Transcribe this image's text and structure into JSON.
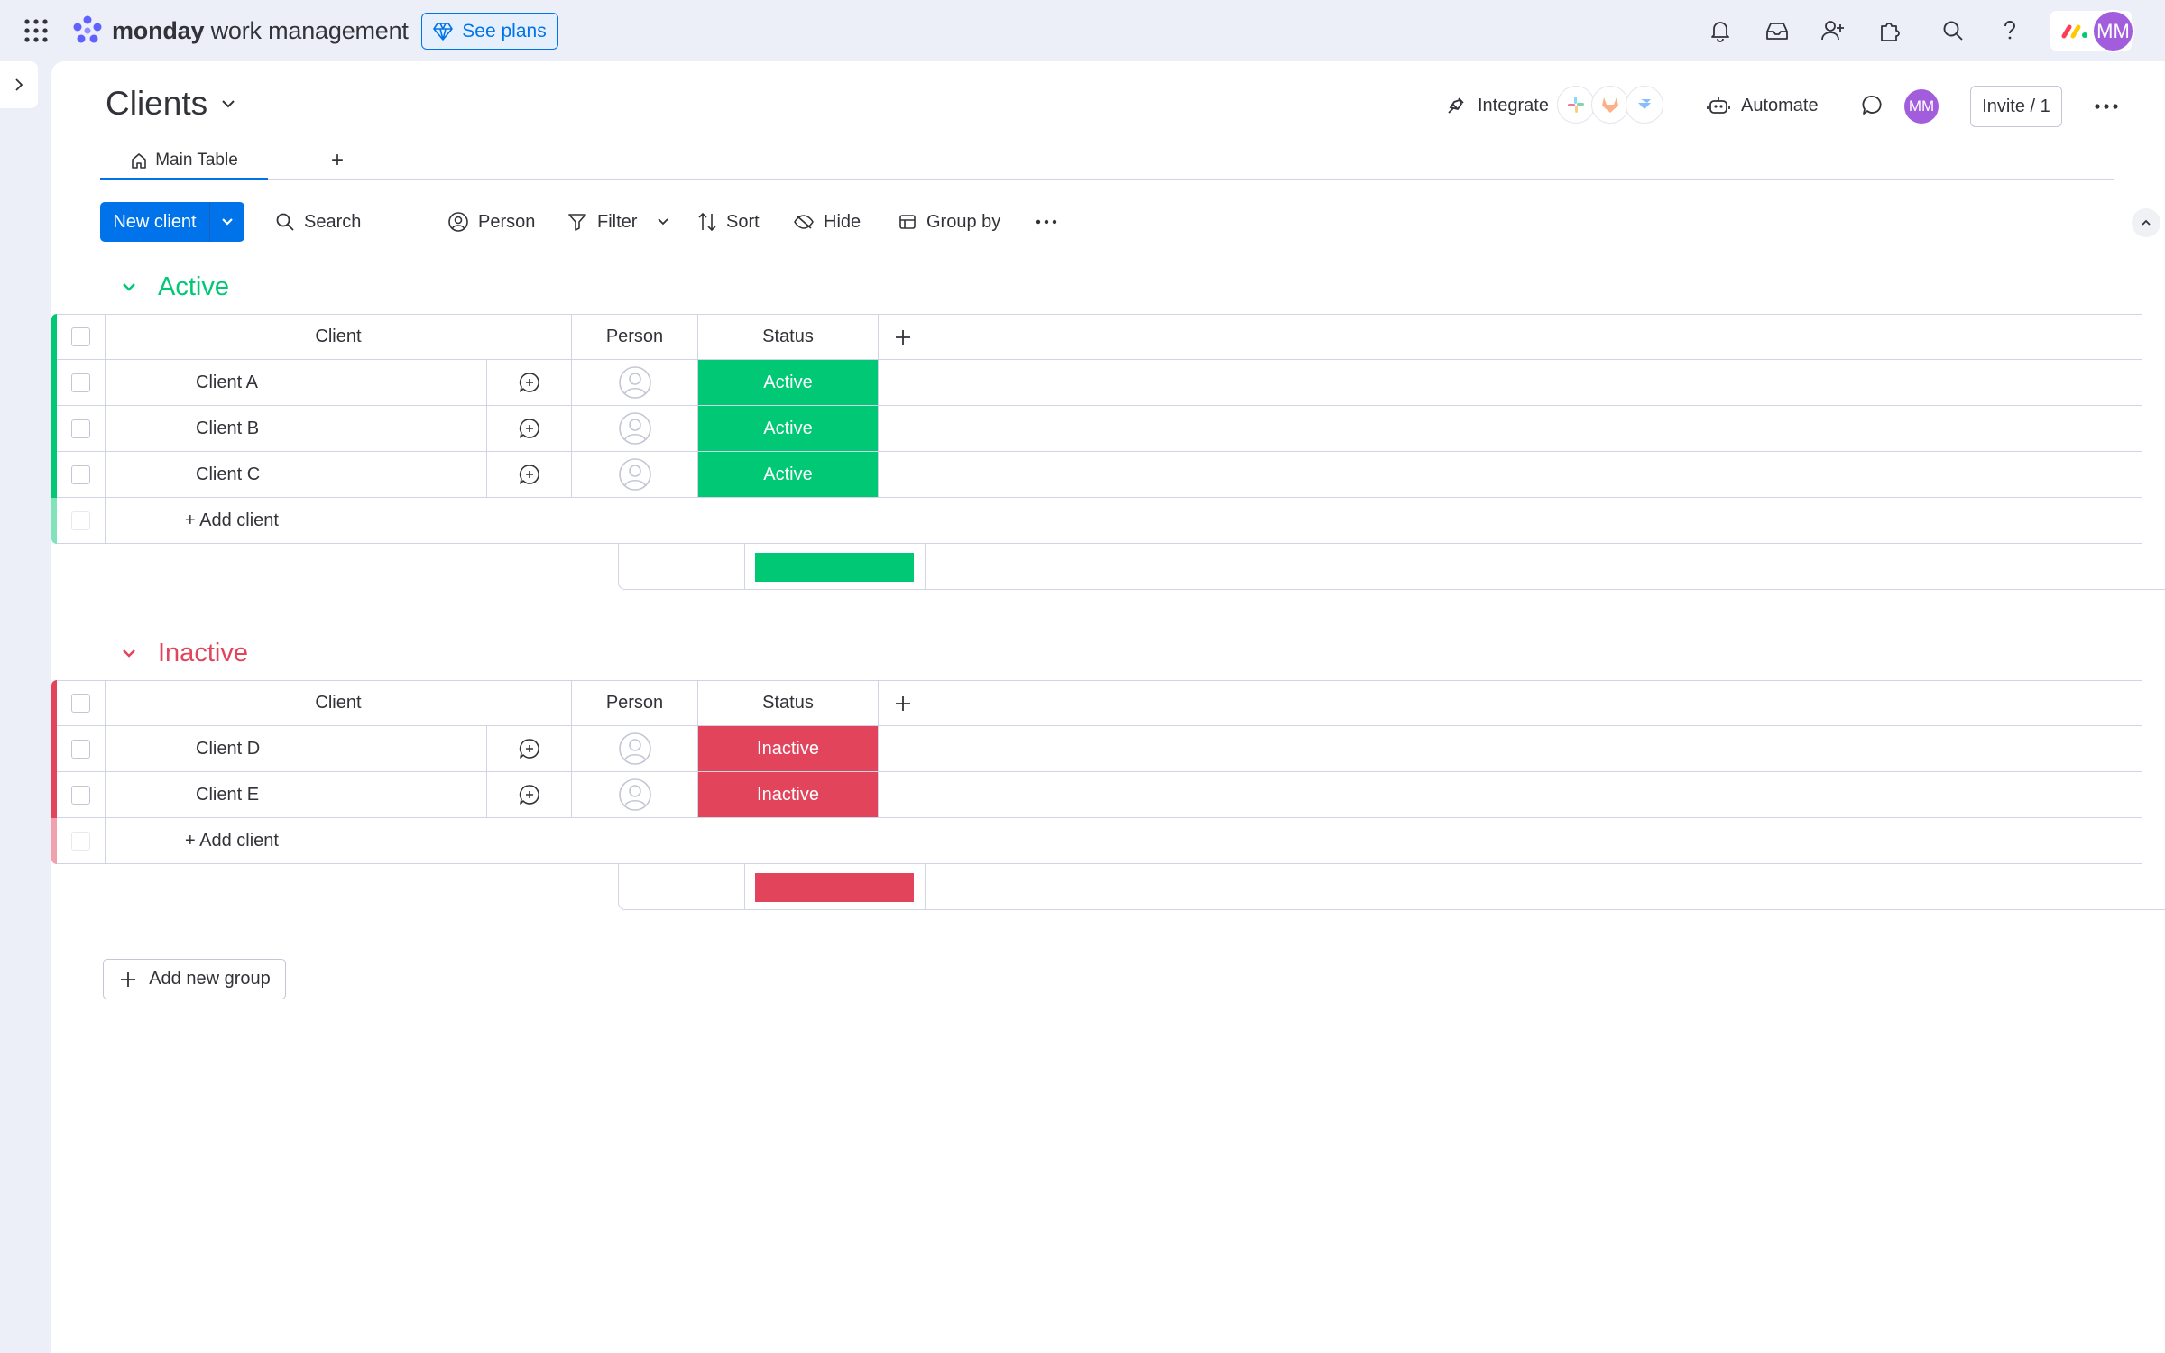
{
  "app": {
    "brand_bold": "monday",
    "brand_rest": " work management",
    "see_plans": "See plans",
    "avatar_initials": "MM"
  },
  "board": {
    "title": "Clients",
    "tabs": [
      {
        "label": "Main Table"
      }
    ],
    "add_tab": "+",
    "integrate": "Integrate",
    "automate": "Automate",
    "invite": "Invite / 1",
    "avatar_initials": "MM"
  },
  "toolbar": {
    "new_item": "New client",
    "search": "Search",
    "person": "Person",
    "filter": "Filter",
    "sort": "Sort",
    "hide": "Hide",
    "group_by": "Group by"
  },
  "columns": {
    "client": "Client",
    "person": "Person",
    "status": "Status"
  },
  "groups": [
    {
      "title": "Active",
      "color": "#00c875",
      "rows": [
        {
          "name": "Client A",
          "status": "Active"
        },
        {
          "name": "Client B",
          "status": "Active"
        },
        {
          "name": "Client C",
          "status": "Active"
        }
      ],
      "add_item": "+ Add client"
    },
    {
      "title": "Inactive",
      "color": "#e2445c",
      "rows": [
        {
          "name": "Client D",
          "status": "Inactive"
        },
        {
          "name": "Client E",
          "status": "Inactive"
        }
      ],
      "add_item": "+ Add client"
    }
  ],
  "add_new_group": "Add new group",
  "colors": {
    "primary": "#0073ea",
    "active": "#00c875",
    "inactive": "#e2445c",
    "avatar": "#a25ddc"
  }
}
